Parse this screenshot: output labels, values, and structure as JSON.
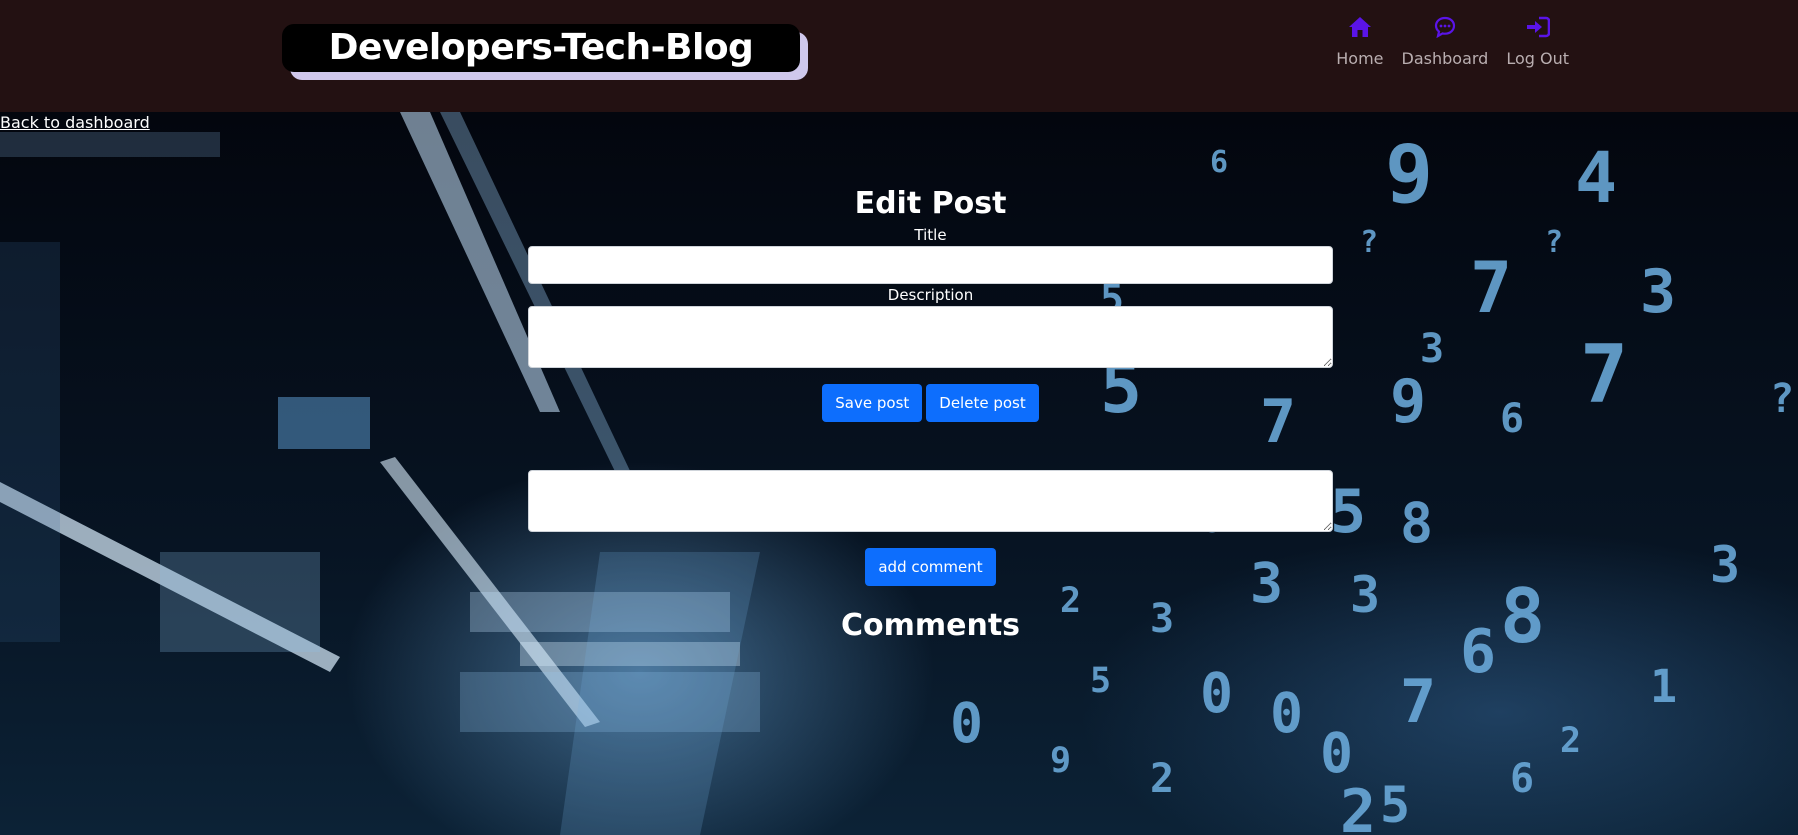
{
  "header": {
    "brand": "Developers-Tech-Blog",
    "nav": [
      {
        "label": "Home",
        "icon": "home-icon"
      },
      {
        "label": "Dashboard",
        "icon": "chat-icon"
      },
      {
        "label": "Log Out",
        "icon": "logout-icon"
      }
    ]
  },
  "back_link": "Back to dashboard",
  "edit_post": {
    "heading": "Edit Post",
    "title_label": "Title",
    "title_value": "",
    "description_label": "Description",
    "description_value": "",
    "save_button": "Save post",
    "delete_button": "Delete post"
  },
  "comment": {
    "value": "",
    "add_button": "add comment",
    "comments_heading": "Comments"
  },
  "colors": {
    "header_bg": "#231112",
    "accent_blue": "#0d6efd",
    "nav_icon": "#5a14e8",
    "logo_shadow": "#cfc8ec"
  }
}
